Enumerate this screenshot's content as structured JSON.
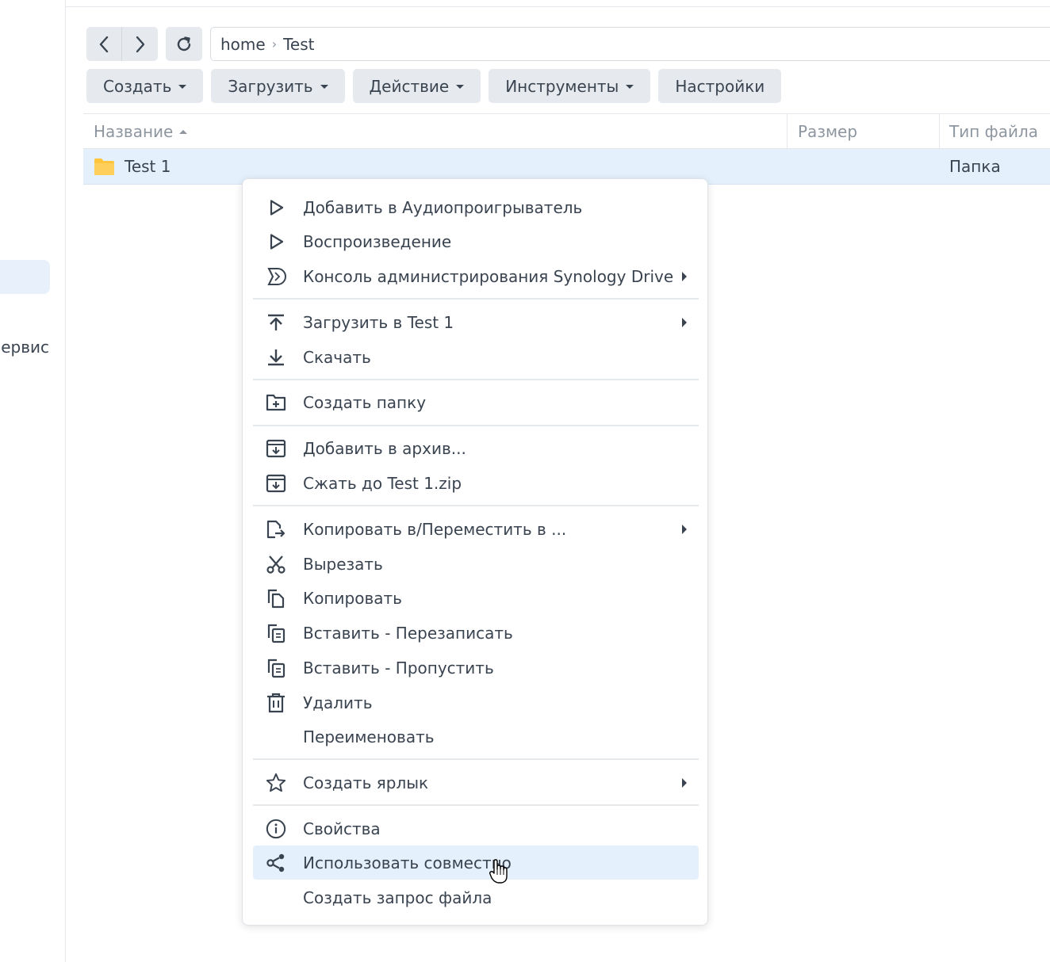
{
  "sidebar": {
    "partial_label": "ервис"
  },
  "nav": {
    "back_icon": "chevron-left-icon",
    "forward_icon": "chevron-right-icon",
    "refresh_icon": "refresh-icon"
  },
  "path": {
    "segments": [
      "home",
      "Test"
    ],
    "separator": "›"
  },
  "toolbar": {
    "create": "Создать",
    "upload": "Загрузить",
    "action": "Действие",
    "tools": "Инструменты",
    "settings": "Настройки"
  },
  "columns": {
    "name": "Название",
    "size": "Размер",
    "type": "Тип файла"
  },
  "rows": [
    {
      "name": "Test 1",
      "size": "",
      "type": "Папка",
      "icon": "folder-icon"
    }
  ],
  "context_menu": {
    "items": [
      {
        "label": "Добавить в Аудиопроигрыватель",
        "icon": "play-icon"
      },
      {
        "label": "Воспроизведение",
        "icon": "play-icon"
      },
      {
        "label": "Консоль администрирования Synology Drive",
        "icon": "drive-icon",
        "submenu": true
      },
      {
        "label": "Загрузить в Test 1",
        "icon": "upload-icon",
        "submenu": true
      },
      {
        "label": "Скачать",
        "icon": "download-icon"
      },
      {
        "label": "Создать папку",
        "icon": "new-folder-icon"
      },
      {
        "label": "Добавить в архив...",
        "icon": "archive-icon"
      },
      {
        "label": "Сжать до Test 1.zip",
        "icon": "archive-icon"
      },
      {
        "label": "Копировать в/Переместить в ...",
        "icon": "move-icon",
        "submenu": true
      },
      {
        "label": "Вырезать",
        "icon": "scissors-icon"
      },
      {
        "label": "Копировать",
        "icon": "copy-icon"
      },
      {
        "label": "Вставить - Перезаписать",
        "icon": "paste-icon"
      },
      {
        "label": "Вставить - Пропустить",
        "icon": "paste-icon"
      },
      {
        "label": "Удалить",
        "icon": "trash-icon"
      },
      {
        "label": "Переименовать",
        "icon": ""
      },
      {
        "label": "Создать ярлык",
        "icon": "star-icon",
        "submenu": true
      },
      {
        "label": "Свойства",
        "icon": "info-icon"
      },
      {
        "label": "Использовать совместно",
        "icon": "share-icon",
        "highlighted": true
      },
      {
        "label": "Создать запрос файла",
        "icon": ""
      }
    ]
  },
  "colors": {
    "accent_bg": "#e4f0fb",
    "button_bg": "#e6eaee",
    "folder": "#ffc53d",
    "text": "#3a4450",
    "muted": "#8d969f"
  }
}
